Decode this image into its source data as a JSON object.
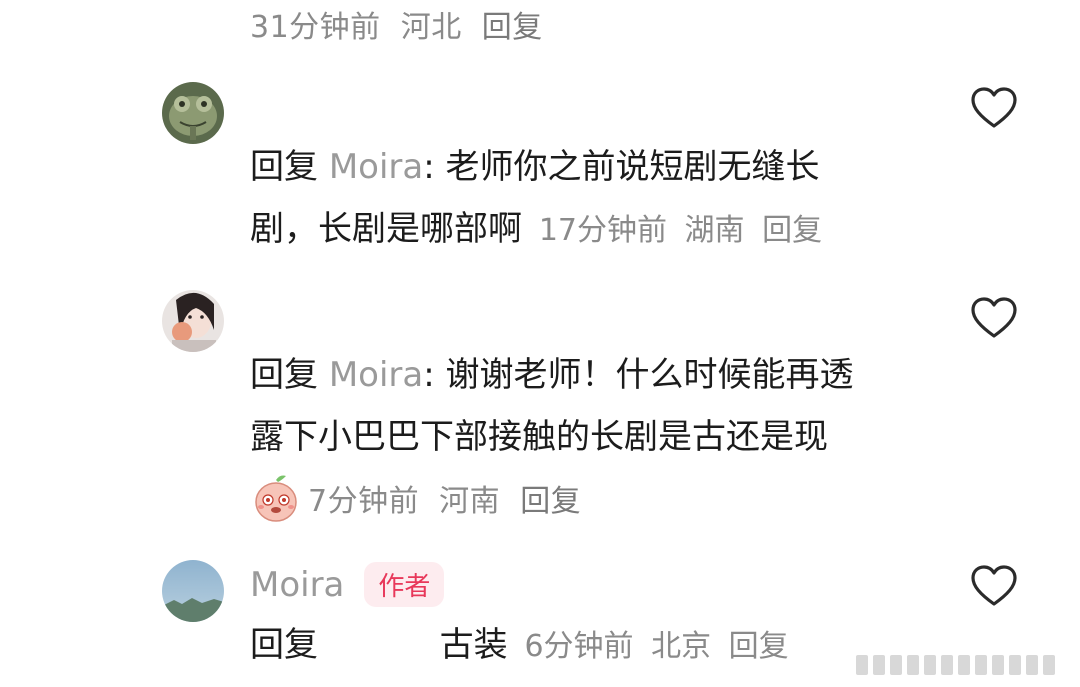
{
  "top_comment_meta": {
    "time": "31分钟前",
    "location": "河北",
    "reply": "回复"
  },
  "comments": [
    {
      "reply_prefix": "回复",
      "mention": "Moira",
      "text": ": 老师你之前说短剧无缝长剧，长剧是哪部啊",
      "line1": ": 老师你之前说短剧无缝长",
      "line2": "剧，长剧是哪部啊",
      "time": "17分钟前",
      "location": "湖南",
      "reply": "回复",
      "avatar_icon": "frog-avatar-icon"
    },
    {
      "reply_prefix": "回复",
      "mention": "Moira",
      "line1": ": 谢谢老师！什么时候能再透",
      "line2": "露下小巴巴下部接触的长剧是古还是现",
      "sticker_icon": "peach-pleading-emoji-icon",
      "time": "7分钟前",
      "location": "河南",
      "reply": "回复",
      "avatar_icon": "girl-avatar-icon"
    },
    {
      "author": "Moira",
      "author_badge": "作者",
      "reply_prefix": "回复",
      "text": "古装",
      "time": "6分钟前",
      "location": "北京",
      "reply": "回复",
      "avatar_icon": "sky-avatar-icon"
    }
  ],
  "colors": {
    "meta_gray": "#8a8a8a",
    "author_badge_bg": "#fdecef",
    "author_badge_text": "#e8385a",
    "heart_stroke": "#2b2b2b"
  }
}
